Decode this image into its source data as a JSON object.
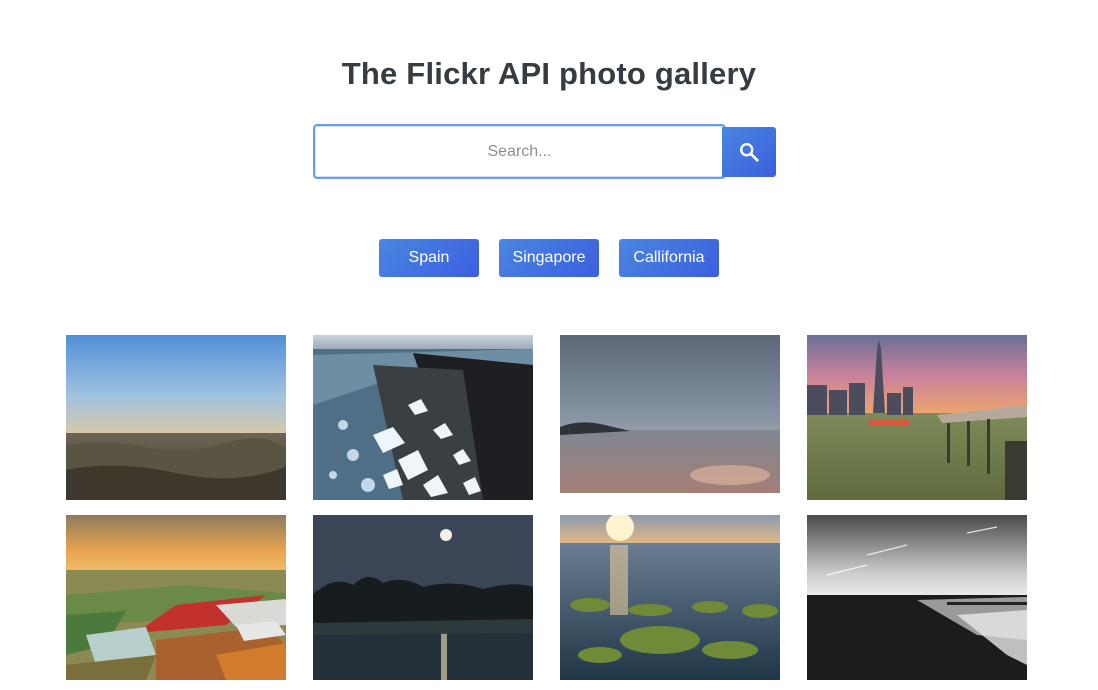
{
  "page": {
    "title": "The Flickr API photo gallery"
  },
  "search": {
    "placeholder": "Search...",
    "value": "",
    "button_icon": "search-icon"
  },
  "quick_searches": [
    {
      "label": "Spain"
    },
    {
      "label": "Singapore"
    },
    {
      "label": "Callifornia"
    }
  ],
  "gallery": {
    "photos": [
      {
        "subject": "dusk landscape with rolling hills under clear blue sky"
      },
      {
        "subject": "ice chunks on black sand beach with waves"
      },
      {
        "subject": "cloudy sunset over calm sea and rocks"
      },
      {
        "subject": "city skyline with tall tower and pier at sunset"
      },
      {
        "subject": "aerial view of farm fields and greenhouses at sunset"
      },
      {
        "subject": "full moon over dark treeline and river"
      },
      {
        "subject": "sunset over sea with green algae on rocks"
      },
      {
        "subject": "black and white beach with pier"
      }
    ]
  },
  "colors": {
    "accent": "#3f6fe0",
    "title": "#353c42",
    "input_border": "#6f9be8"
  }
}
